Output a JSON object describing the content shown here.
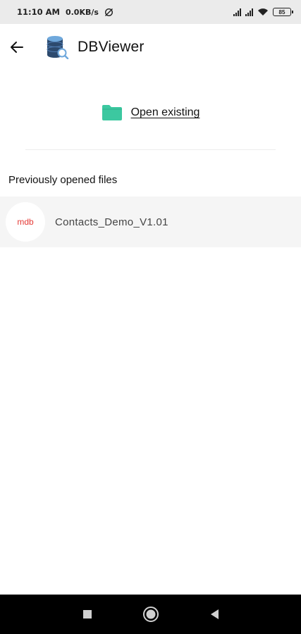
{
  "status_bar": {
    "time": "11:10 AM",
    "net_speed": "0.0KB/s",
    "battery": "85"
  },
  "app_bar": {
    "title": "DBViewer",
    "back_icon": "arrow-left-icon",
    "logo_icon": "database-search-icon"
  },
  "open_existing": {
    "label": "Open existing",
    "icon": "folder-icon",
    "icon_color": "#3cc8a0"
  },
  "recent": {
    "heading": "Previously opened files",
    "files": [
      {
        "badge": "mdb",
        "name": "Contacts_Demo_V1.01",
        "badge_color": "#e53935"
      }
    ]
  },
  "nav_bar": {
    "buttons": [
      "recents-square-icon",
      "home-circle-icon",
      "back-triangle-icon"
    ]
  }
}
